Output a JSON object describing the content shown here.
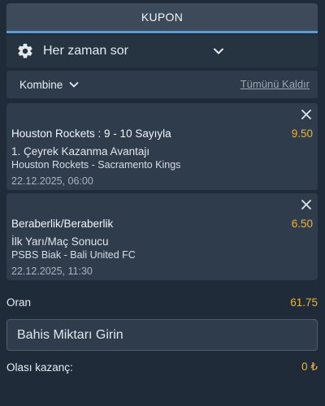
{
  "header": {
    "title": "KUPON"
  },
  "odds_change": {
    "label": "Her zaman sor",
    "icon": "gear-icon",
    "expand_icon": "chevron-down-icon"
  },
  "bet_type": {
    "label": "Kombine",
    "icon": "chevron-down-icon",
    "clear_all": "Tümünü Kaldır"
  },
  "bets": [
    {
      "selection": "Houston Rockets : 9 - 10 Sayıyla",
      "odds": "9.50",
      "market": "1. Çeyrek Kazanma Avantajı",
      "match": "Houston Rockets - Sacramento Kings",
      "date": "22.12.2025, 06:00"
    },
    {
      "selection": "Beraberlik/Beraberlik",
      "odds": "6.50",
      "market": "İlk Yarı/Maç Sonucu",
      "match": "PSBS Biak - Bali United FC",
      "date": "22.12.2025, 11:30"
    }
  ],
  "summary": {
    "odds_label": "Oran",
    "odds_value": "61.75",
    "stake_placeholder": "Bahis Miktarı Girin",
    "potential_label": "Olası kazanç:",
    "potential_value": "0 ₺"
  },
  "colors": {
    "background": "#1f2b38",
    "card": "#2f3c4c",
    "accent_odds": "#f0b530",
    "header_underline": "#5b9bd5"
  }
}
